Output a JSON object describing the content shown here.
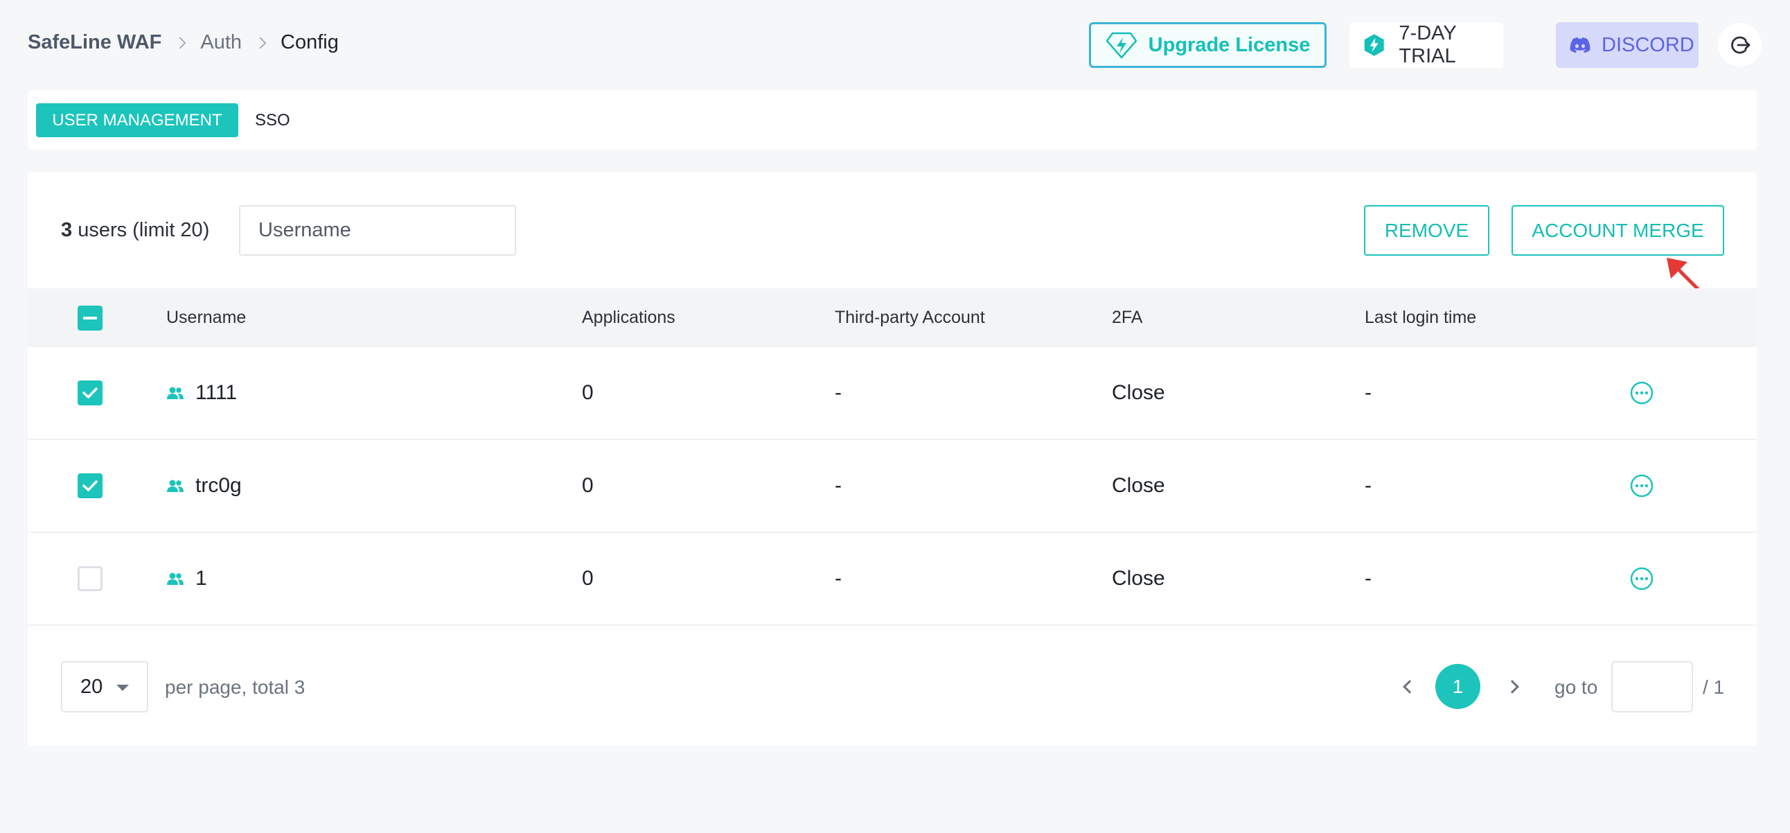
{
  "breadcrumb": {
    "root": "SafeLine WAF",
    "section": "Auth",
    "current": "Config"
  },
  "header": {
    "upgrade_label": "Upgrade License",
    "trial_label": "7-DAY TRIAL",
    "discord_label": "DISCORD"
  },
  "tabs": [
    {
      "label": "USER MANAGEMENT",
      "active": true
    },
    {
      "label": "SSO",
      "active": false
    }
  ],
  "toolbar": {
    "user_count": "3",
    "user_count_suffix": "users (limit 20)",
    "search_placeholder": "Username",
    "remove_label": "REMOVE",
    "merge_label": "ACCOUNT MERGE"
  },
  "table": {
    "columns": [
      "Username",
      "Applications",
      "Third-party Account",
      "2FA",
      "Last login time"
    ],
    "rows": [
      {
        "checked": true,
        "username": "1111",
        "applications": "0",
        "third_party": "-",
        "twofa": "Close",
        "last_login": "-"
      },
      {
        "checked": true,
        "username": "trc0g",
        "applications": "0",
        "third_party": "-",
        "twofa": "Close",
        "last_login": "-"
      },
      {
        "checked": false,
        "username": "1",
        "applications": "0",
        "third_party": "-",
        "twofa": "Close",
        "last_login": "-"
      }
    ]
  },
  "pagination": {
    "page_size": "20",
    "info": "per page, total 3",
    "current_page": "1",
    "goto_label": "go to",
    "total_pages": "/ 1"
  },
  "colors": {
    "accent": "#1cc4bb",
    "discord": "#5a63e8",
    "annotation": "#e53935"
  },
  "icons": [
    "chevron-right-icon",
    "diamond-bolt-icon",
    "trial-bolt-icon",
    "discord-icon",
    "logout-icon",
    "users-icon",
    "more-icon",
    "caret-down-icon",
    "chevron-left-icon",
    "red-arrow-icon"
  ]
}
